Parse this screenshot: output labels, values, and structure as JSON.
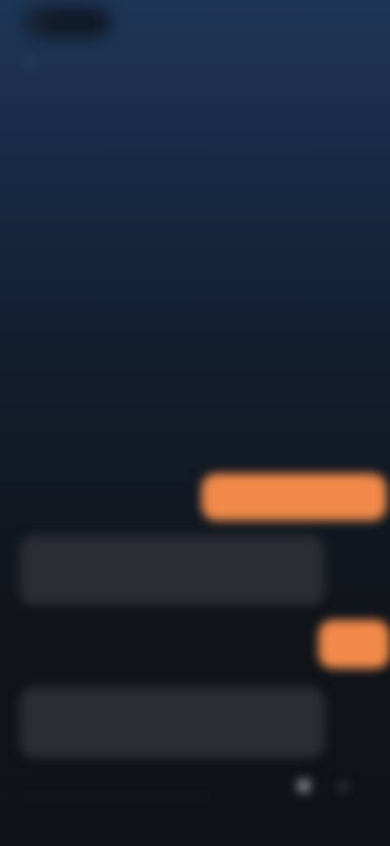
{
  "status": {
    "label": ""
  },
  "header": {
    "title": ""
  },
  "chat": {
    "timestamp": "",
    "messages": [
      {
        "role": "user",
        "text": ""
      },
      {
        "role": "assistant",
        "lines": [
          "",
          ""
        ]
      },
      {
        "role": "user",
        "text": ""
      },
      {
        "role": "assistant",
        "lines": [
          "",
          ""
        ]
      }
    ]
  },
  "composer": {
    "placeholder": ""
  },
  "colors": {
    "accent": "#f0894a",
    "assistant_bubble": "#2a2d33",
    "background_top": "#1e3656",
    "background_bottom": "#0f1216"
  },
  "icons": [
    "back-icon",
    "mic-icon",
    "send-icon"
  ]
}
